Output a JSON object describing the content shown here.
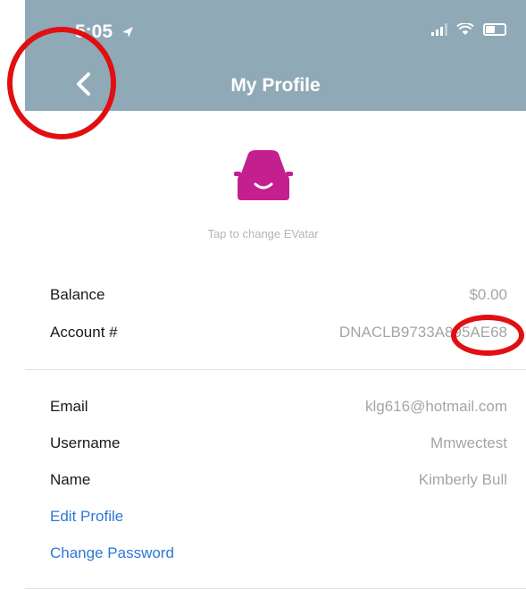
{
  "status_bar": {
    "time": "5:05"
  },
  "header": {
    "title": "My Profile"
  },
  "avatar": {
    "caption": "Tap to change EVatar"
  },
  "account": [
    {
      "label": "Balance",
      "value": "$0.00"
    },
    {
      "label": "Account #",
      "value": "DNACLB9733A895AE68"
    }
  ],
  "profile": [
    {
      "label": "Email",
      "value": "klg616@hotmail.com"
    },
    {
      "label": "Username",
      "value": "Mmwectest"
    },
    {
      "label": "Name",
      "value": "Kimberly Bull"
    }
  ],
  "actions": {
    "edit_profile": "Edit Profile",
    "change_password": "Change Password"
  },
  "colors": {
    "header_bg": "#8fa9b6",
    "avatar": "#c41f8f",
    "link": "#2b78d8",
    "annotation": "#e10f12"
  }
}
